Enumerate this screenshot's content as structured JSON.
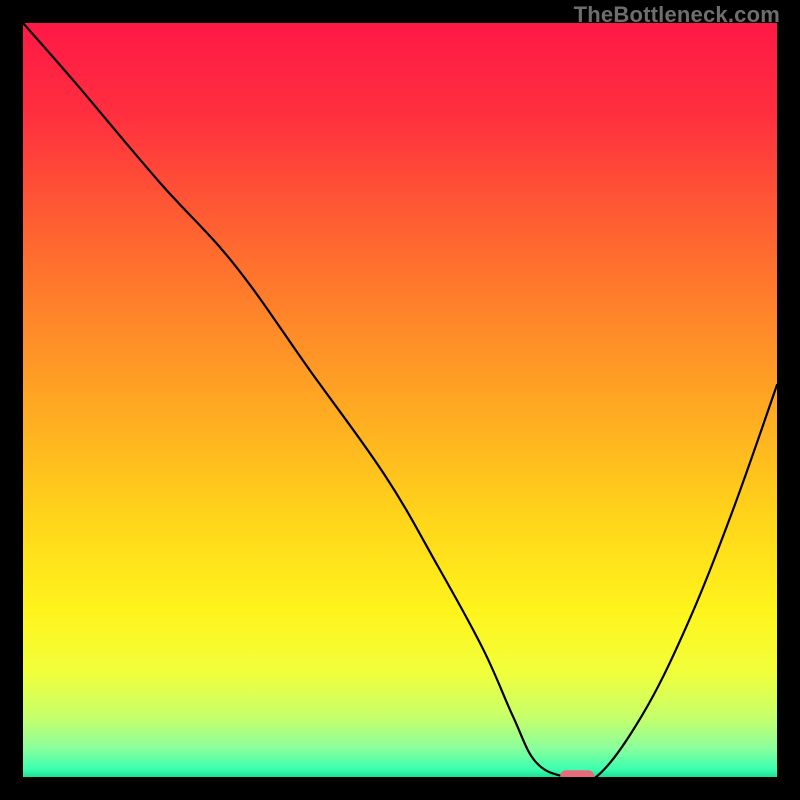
{
  "watermark": "TheBottleneck.com",
  "chart_data": {
    "type": "line",
    "title": "",
    "xlabel": "",
    "ylabel": "",
    "xlim": [
      0,
      100
    ],
    "ylim": [
      0,
      100
    ],
    "gradient_stops": [
      {
        "offset": 0.0,
        "color": "#ff1846"
      },
      {
        "offset": 0.12,
        "color": "#ff2f3f"
      },
      {
        "offset": 0.3,
        "color": "#ff6a2f"
      },
      {
        "offset": 0.48,
        "color": "#ffa024"
      },
      {
        "offset": 0.65,
        "color": "#ffd31a"
      },
      {
        "offset": 0.78,
        "color": "#fff41c"
      },
      {
        "offset": 0.86,
        "color": "#f1ff3a"
      },
      {
        "offset": 0.92,
        "color": "#c7ff6a"
      },
      {
        "offset": 0.96,
        "color": "#8dff9a"
      },
      {
        "offset": 0.99,
        "color": "#3bffb0"
      },
      {
        "offset": 1.0,
        "color": "#1ae093"
      }
    ],
    "series": [
      {
        "name": "bottleneck-curve",
        "x": [
          0,
          7,
          18,
          28,
          38,
          48,
          55,
          61,
          65,
          68,
          72,
          76,
          82,
          88,
          94,
          100
        ],
        "y": [
          100,
          92,
          79,
          68,
          54,
          40,
          28,
          17,
          8,
          2,
          0,
          0,
          8,
          20,
          35,
          52
        ]
      }
    ],
    "marker": {
      "name": "optimal-marker",
      "x": 73.5,
      "y": 0,
      "color": "#e96b79",
      "width": 4.5,
      "height": 1.8
    }
  }
}
